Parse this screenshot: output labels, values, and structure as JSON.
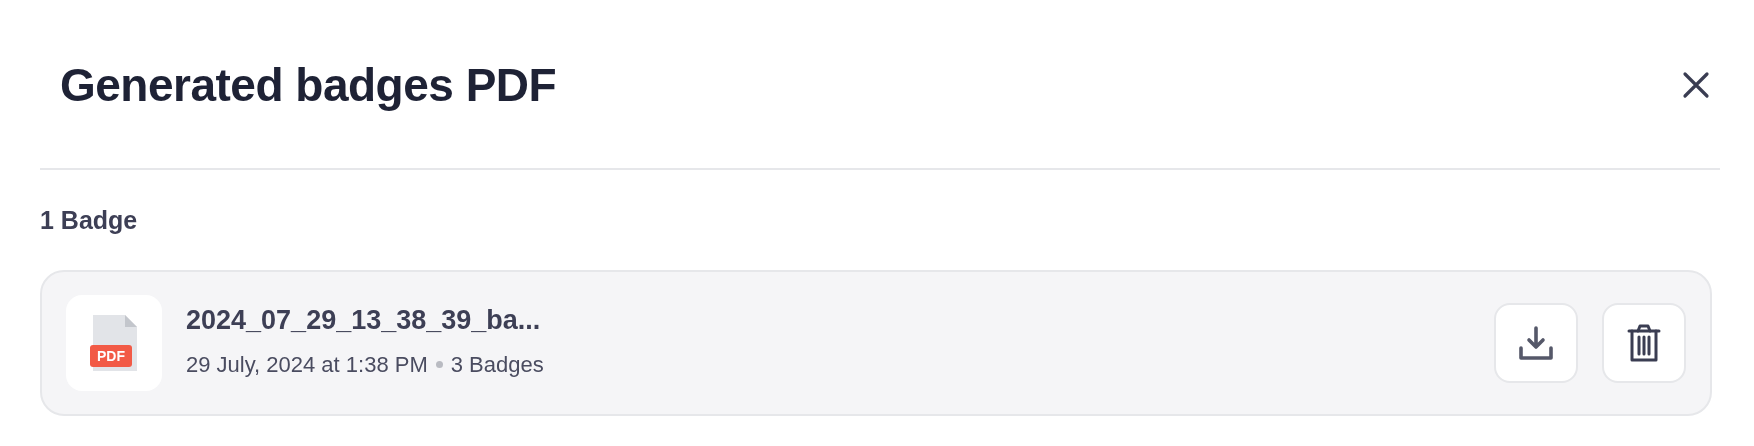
{
  "dialog": {
    "title": "Generated badges PDF"
  },
  "count_label": "1 Badge",
  "files": [
    {
      "kind": "pdf",
      "file_badge": "PDF",
      "name": "2024_07_29_13_38_39_ba...",
      "date": "29 July, 2024 at 1:38 PM",
      "count": "3 Badges"
    }
  ]
}
